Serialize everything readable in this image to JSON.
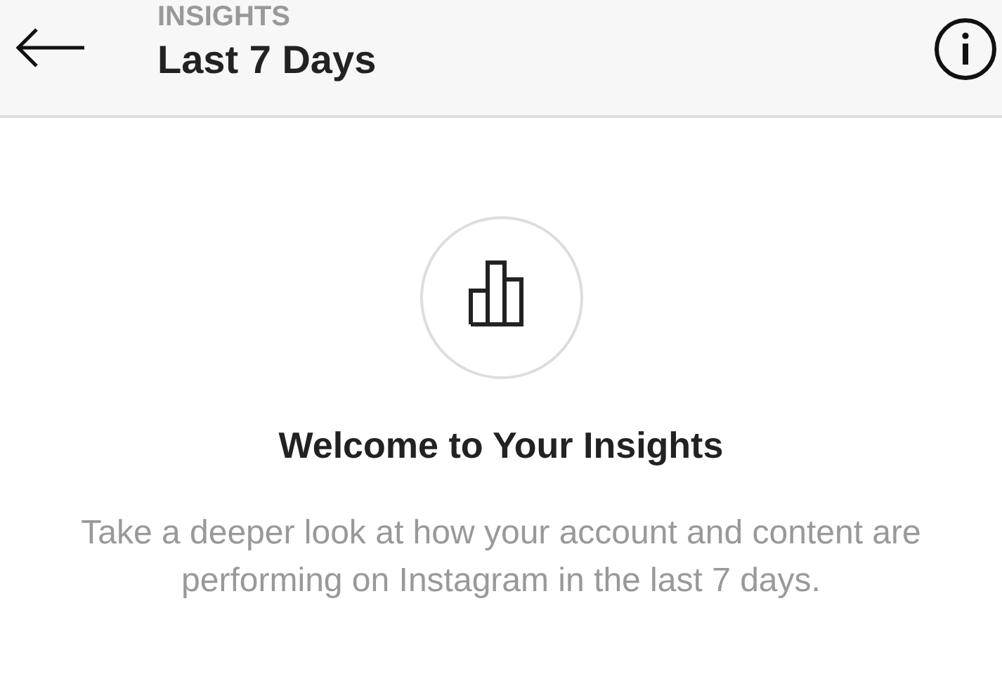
{
  "header": {
    "subtitle": "INSIGHTS",
    "title": "Last 7 Days"
  },
  "welcome": {
    "heading": "Welcome to Your Insights",
    "body": "Take a deeper look at how your account and content are performing on Instagram in the last 7 days."
  }
}
